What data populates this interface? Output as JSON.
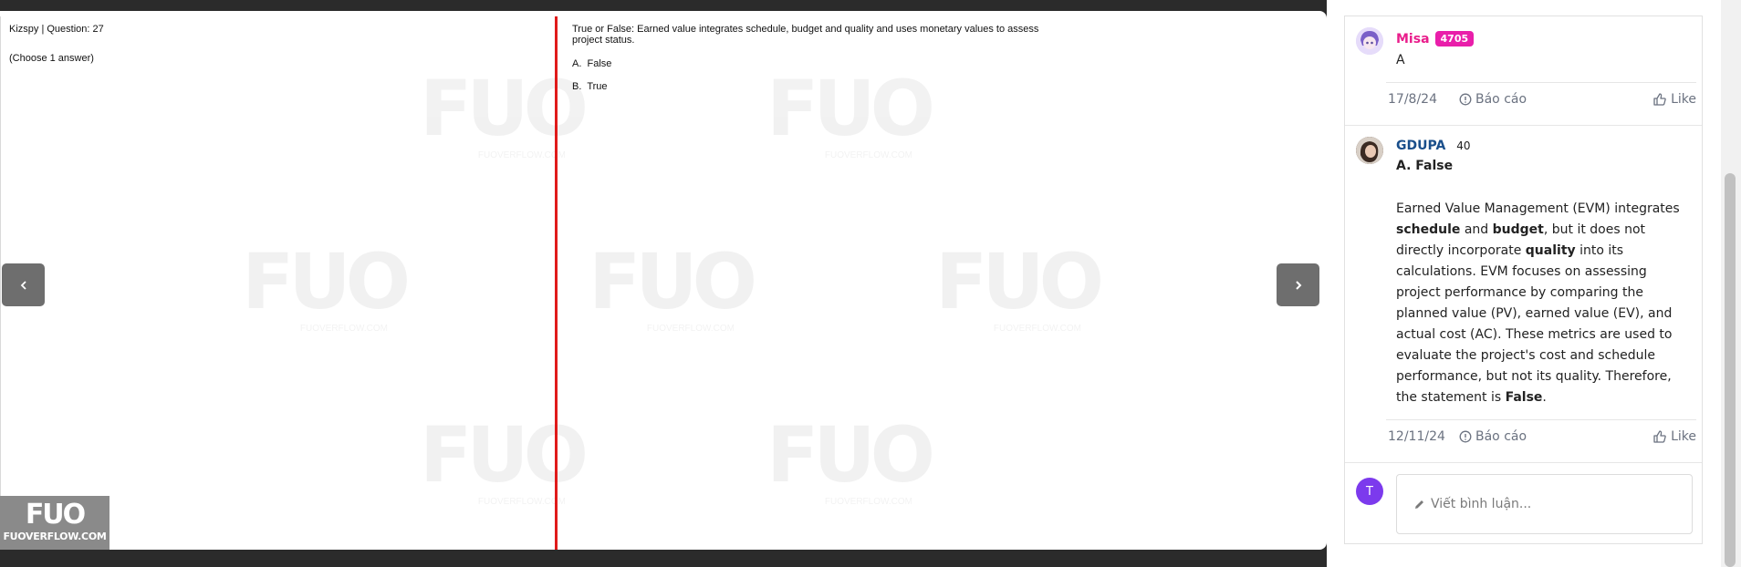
{
  "viewer": {
    "question_header": "Kizspy | Question: 27",
    "choose_hint": "(Choose 1 answer)",
    "question_text": "True or False: Earned value integrates schedule, budget and quality and uses monetary values to assess project status.",
    "options": [
      {
        "label": "A.",
        "text": "False"
      },
      {
        "label": "B.",
        "text": "True"
      }
    ],
    "watermark_big": "FUO",
    "watermark_small": "FUOVERFLOW.COM",
    "logo_top": "FUO",
    "logo_site": "FUOVERFLOW.COM",
    "prev_icon": "chevron-left-icon",
    "next_icon": "chevron-right-icon",
    "divider_color": "#e01b1b"
  },
  "comments": [
    {
      "author": "Misa",
      "badge": "4705",
      "body": "A",
      "date": "17/8/24",
      "report_label": "Báo cáo",
      "like_label": "Like"
    },
    {
      "author": "GDUPA",
      "score": "40",
      "answer": "A. False",
      "explanation_parts": [
        "Earned Value Management (EVM) integrates ",
        "schedule",
        " and ",
        "budget",
        ", but it does not directly incorporate ",
        "quality",
        " into its calculations. EVM focuses on assessing project performance by comparing the planned value (PV), earned value (EV), and actual cost (AC). These metrics are used to evaluate the project's cost and schedule performance, but not its quality. Therefore, the statement is ",
        "False",
        "."
      ],
      "date": "12/11/24",
      "report_label": "Báo cáo",
      "like_label": "Like"
    }
  ],
  "new_comment": {
    "avatar_initial": "T",
    "placeholder": "Viết bình luận..."
  },
  "colors": {
    "brand_pink": "#e91e8c",
    "author_blue": "#1a4f8b",
    "badge_pink": "#e91eaa",
    "avatar_purple": "#7c3aed"
  }
}
